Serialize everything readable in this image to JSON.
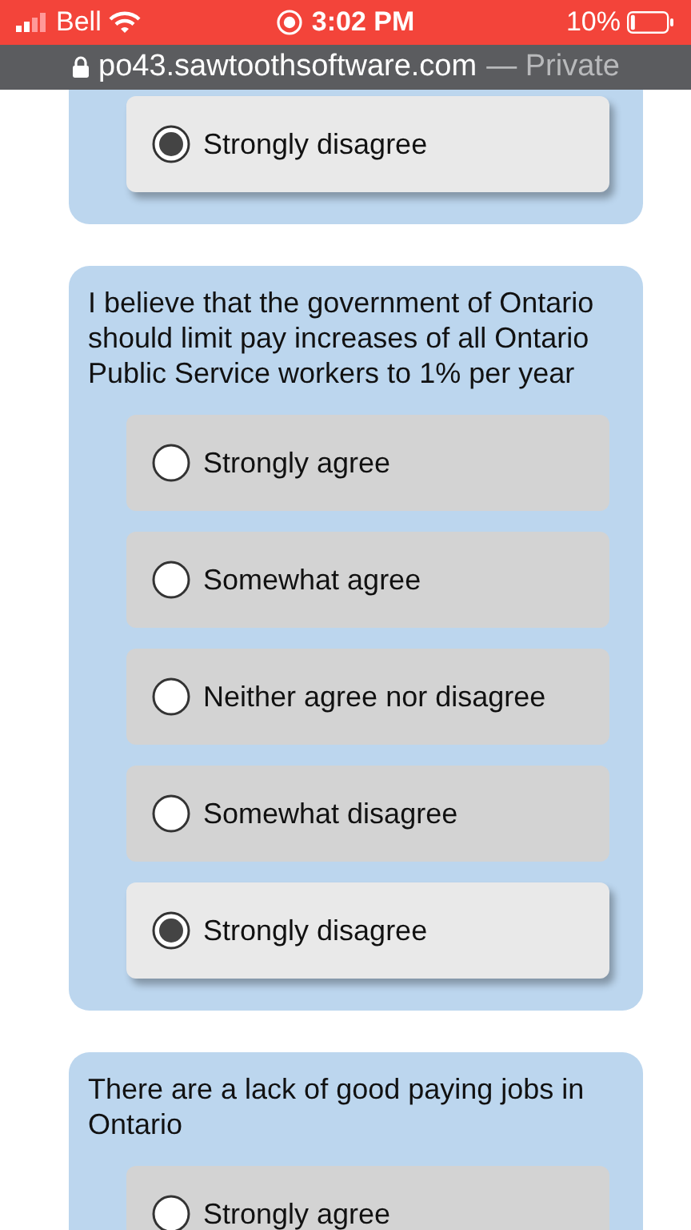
{
  "status_bar": {
    "carrier": "Bell",
    "time": "3:02 PM",
    "battery": "10%"
  },
  "address_bar": {
    "url": "po43.sawtoothsoftware.com",
    "mode": "— Private"
  },
  "questions": [
    {
      "options": [
        {
          "label": "Strongly disagree",
          "selected": true
        }
      ]
    },
    {
      "text": "I believe that the government of Ontario should limit pay increases of all Ontario Public Service workers to 1% per year",
      "options": [
        {
          "label": "Strongly agree",
          "selected": false
        },
        {
          "label": "Somewhat agree",
          "selected": false
        },
        {
          "label": "Neither agree nor disagree",
          "selected": false
        },
        {
          "label": "Somewhat disagree",
          "selected": false
        },
        {
          "label": "Strongly disagree",
          "selected": true
        }
      ]
    },
    {
      "text": "There are a lack of good paying jobs in Ontario",
      "options": [
        {
          "label": "Strongly agree",
          "selected": false
        }
      ]
    }
  ]
}
